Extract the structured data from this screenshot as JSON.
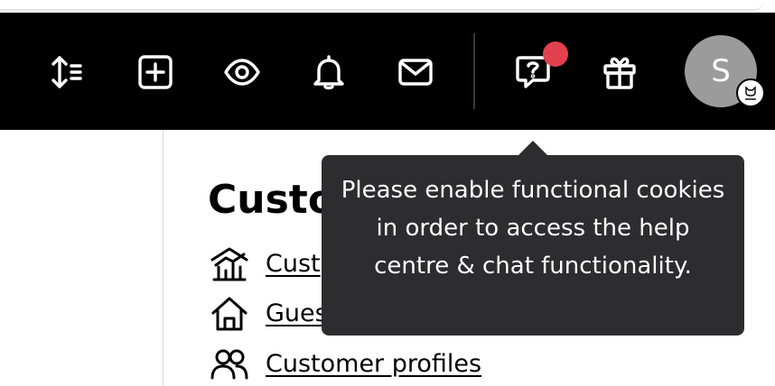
{
  "navbar": {
    "icons": [
      "sort-icon",
      "add-square-icon",
      "eye-icon",
      "bell-icon",
      "mail-icon",
      "help-chat-icon",
      "gift-icon"
    ],
    "notification_dot_color": "#e2404e",
    "avatar": {
      "initial": "S",
      "background": "#9b9b9b"
    }
  },
  "main": {
    "section_title": "Custo",
    "menu": [
      {
        "label": "Cust",
        "icon": "analytics-house-icon"
      },
      {
        "label": "Gues",
        "icon": "home-icon"
      },
      {
        "label": "Customer profiles",
        "icon": "users-icon"
      }
    ]
  },
  "tooltip": {
    "text": "Please enable functional cookies in order to access the help centre & chat functionality."
  },
  "colors": {
    "navbar_bg": "#000000",
    "tooltip_bg": "#2d2d2f"
  }
}
